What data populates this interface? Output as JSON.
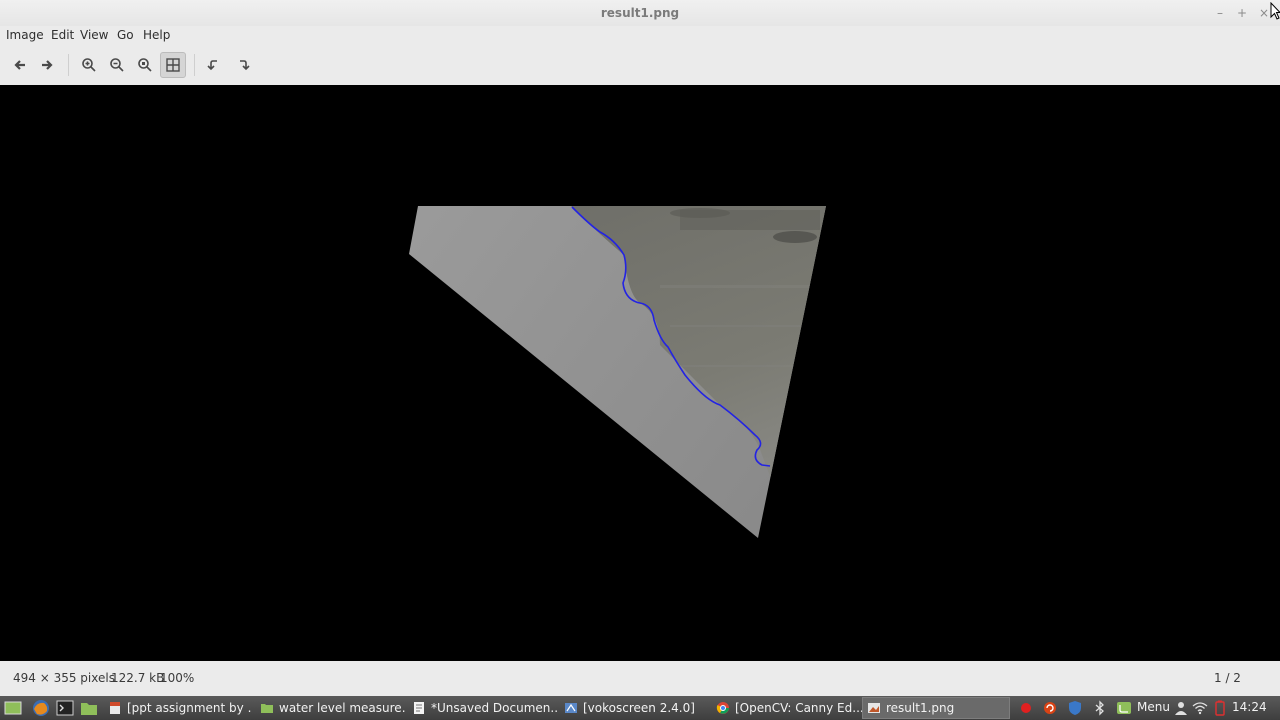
{
  "window": {
    "title": "result1.png",
    "controls": [
      "–",
      "+",
      "×"
    ]
  },
  "menubar": {
    "items": [
      "Image",
      "Edit",
      "View",
      "Go",
      "Help"
    ]
  },
  "toolbar": {
    "buttons": [
      "previous",
      "next",
      "zoom-in",
      "zoom-out",
      "zoom-normal",
      "best-fit",
      "rotate-left",
      "rotate-right"
    ],
    "active": "best-fit"
  },
  "status": {
    "dimensions": "494 × 355 pixels",
    "file_size": "122.7 kB",
    "zoom": "100%",
    "position": "1 / 2"
  },
  "taskbar": {
    "tasks": [
      {
        "label": "[ppt assignment by ...",
        "icon": "document-icon"
      },
      {
        "label": "water level measure...",
        "icon": "folder-icon"
      },
      {
        "label": "*Unsaved Documen...",
        "icon": "text-editor-icon"
      },
      {
        "label": "[vokoscreen 2.4.0]",
        "icon": "vokoscreen-icon"
      },
      {
        "label": "[OpenCV: Canny Ed...",
        "icon": "chrome-icon"
      },
      {
        "label": "result1.png",
        "icon": "image-viewer-icon"
      }
    ],
    "menu_label": "Menu",
    "clock": "14:24"
  },
  "colors": {
    "accent_line": "#2222e0",
    "viewer_bg": "#000000",
    "panel_bg": "#ebebeb",
    "taskbar_bg": "#4a4a4a"
  }
}
